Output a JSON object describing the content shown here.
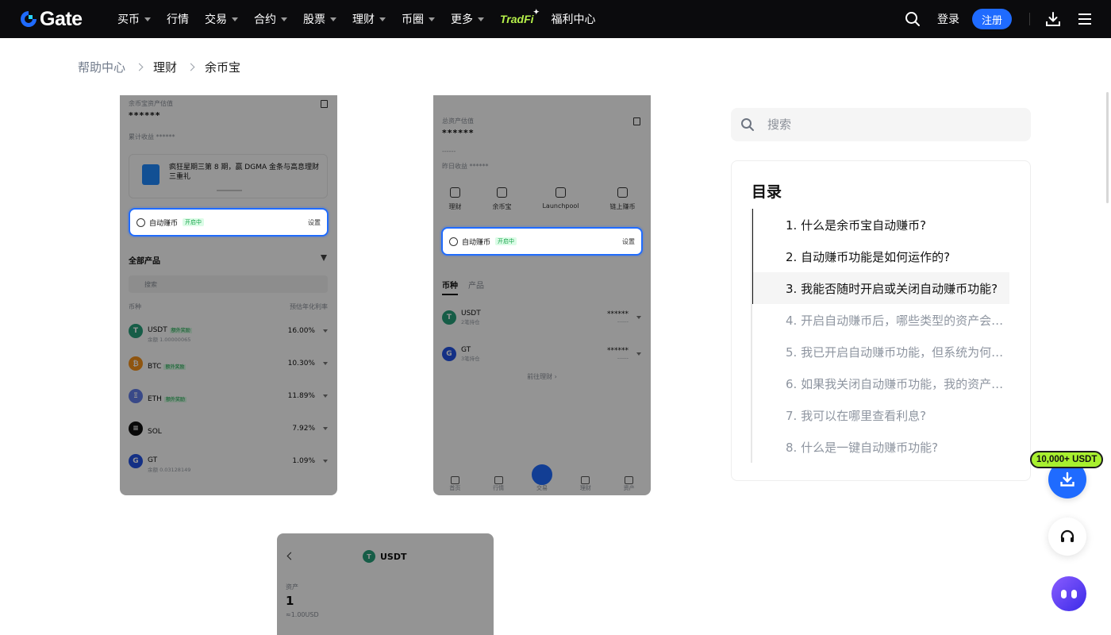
{
  "brand": {
    "name": "Gate",
    "accent": "#1f6bff",
    "nav_bg": "#0b0b0d"
  },
  "nav": {
    "items": [
      {
        "label": "买币",
        "dropdown": true
      },
      {
        "label": "行情",
        "dropdown": false
      },
      {
        "label": "交易",
        "dropdown": true
      },
      {
        "label": "合约",
        "dropdown": true
      },
      {
        "label": "股票",
        "dropdown": true
      },
      {
        "label": "理财",
        "dropdown": true
      },
      {
        "label": "币圈",
        "dropdown": true
      },
      {
        "label": "更多",
        "dropdown": true
      }
    ],
    "tradfi": "TradFi",
    "welfare": "福利中心",
    "login": "登录",
    "signup": "注册"
  },
  "breadcrumb": {
    "home": "帮助中心",
    "section": "理财",
    "current": "余币宝"
  },
  "shot1": {
    "asset_label": "余币宝资产估值",
    "asset_value": "******",
    "income_label": "累计收益 ******",
    "banner": "疯狂星期三第 8 期，赢 DGMA 金条与高息理财三重礼",
    "auto_label": "自动赚币",
    "auto_status": "开启中",
    "auto_set": "设置",
    "all_products": "全部产品",
    "search": "搜索",
    "col_coin": "币种",
    "col_rate": "预估年化利率",
    "coins": [
      {
        "name": "USDT",
        "tag": "额外奖励",
        "sub": "余额 1.00000065",
        "rate": "16.00%",
        "color": "#26a17b",
        "glyph": "T"
      },
      {
        "name": "BTC",
        "tag": "额外奖励",
        "sub": "",
        "rate": "10.30%",
        "color": "#f7931a",
        "glyph": "₿"
      },
      {
        "name": "ETH",
        "tag": "额外奖励",
        "sub": "",
        "rate": "11.89%",
        "color": "#627eea",
        "glyph": "Ξ"
      },
      {
        "name": "SOL",
        "tag": "",
        "sub": "",
        "rate": "7.92%",
        "color": "#111111",
        "glyph": "≡"
      },
      {
        "name": "GT",
        "tag": "",
        "sub": "余额 0.03128149",
        "rate": "1.09%",
        "color": "#2354e6",
        "glyph": "G"
      }
    ]
  },
  "shot2": {
    "asset_label": "总资产估值",
    "asset_value": "******",
    "sub_value": "------",
    "income_label": "昨日收益 ******",
    "quick": [
      "理财",
      "余币宝",
      "Launchpool",
      "链上赚币"
    ],
    "auto_label": "自动赚币",
    "auto_status": "开启中",
    "auto_set": "设置",
    "tab_coin": "币种",
    "tab_product": "产品",
    "rows": [
      {
        "name": "USDT",
        "sub": "2笔持仓",
        "value": "******",
        "value2": "------",
        "color": "#26a17b",
        "glyph": "T"
      },
      {
        "name": "GT",
        "sub": "3笔持仓",
        "value": "******",
        "value2": "------",
        "color": "#2354e6",
        "glyph": "G"
      }
    ],
    "goto": "前往理财 ›",
    "bottom_nav": [
      "首页",
      "行情",
      "交易",
      "理财",
      "资产"
    ]
  },
  "shot3": {
    "title": "USDT",
    "asset_label": "资产",
    "asset_value": "1",
    "asset_sub": "≈1.00USD"
  },
  "search": {
    "placeholder": "搜索"
  },
  "toc": {
    "title": "目录",
    "items": [
      {
        "label": "1. 什么是余币宝自动赚币?",
        "state": "done"
      },
      {
        "label": "2. 自动赚币功能是如何运作的?",
        "state": "done"
      },
      {
        "label": "3. 我能否随时开启或关闭自动赚币功能?",
        "state": "active"
      },
      {
        "label": "4. 开启自动赚币后，哪些类型的资产会参与?",
        "state": "todo"
      },
      {
        "label": "5. 我已开启自动赚币功能，但系统为何没有申购?",
        "state": "todo"
      },
      {
        "label": "6. 如果我关闭自动赚币功能，我的资产会怎样?",
        "state": "todo"
      },
      {
        "label": "7. 我可以在哪里查看利息?",
        "state": "todo"
      },
      {
        "label": "8. 什么是一键自动赚币功能?",
        "state": "todo"
      }
    ]
  },
  "floating": {
    "reward": "10,000+ USDT"
  }
}
